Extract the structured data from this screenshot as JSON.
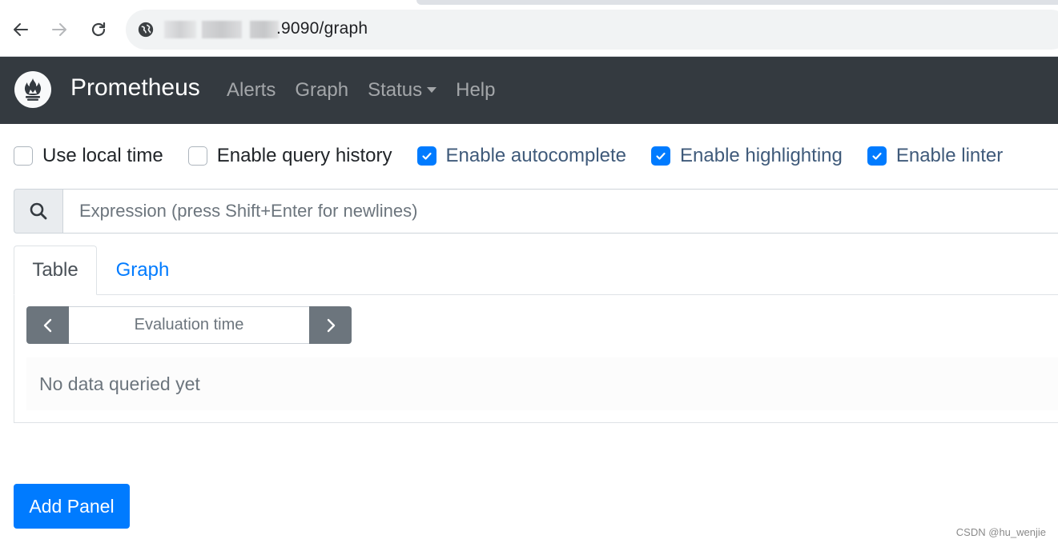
{
  "browser": {
    "url": ".9090/graph",
    "icons": [
      "back-icon",
      "forward-icon",
      "reload-icon",
      "site-info-icon"
    ]
  },
  "navbar": {
    "brand": "Prometheus",
    "links": [
      {
        "label": "Alerts"
      },
      {
        "label": "Graph"
      },
      {
        "label": "Status",
        "has_dropdown": true
      },
      {
        "label": "Help"
      }
    ],
    "bg_color": "#343a40"
  },
  "options": [
    {
      "label": "Use local time",
      "checked": false
    },
    {
      "label": "Enable query history",
      "checked": false
    },
    {
      "label": "Enable autocomplete",
      "checked": true
    },
    {
      "label": "Enable highlighting",
      "checked": true
    },
    {
      "label": "Enable linter",
      "checked": true
    }
  ],
  "expression": {
    "placeholder": "Expression (press Shift+Enter for newlines)",
    "value": ""
  },
  "panel": {
    "tabs": [
      {
        "label": "Table",
        "active": true
      },
      {
        "label": "Graph",
        "active": false
      }
    ],
    "eval_time_placeholder": "Evaluation time",
    "no_data_text": "No data queried yet"
  },
  "add_panel_label": "Add Panel",
  "watermark": "CSDN @hu_wenjie",
  "colors": {
    "accent": "#007bff",
    "secondary": "#6c757d"
  }
}
